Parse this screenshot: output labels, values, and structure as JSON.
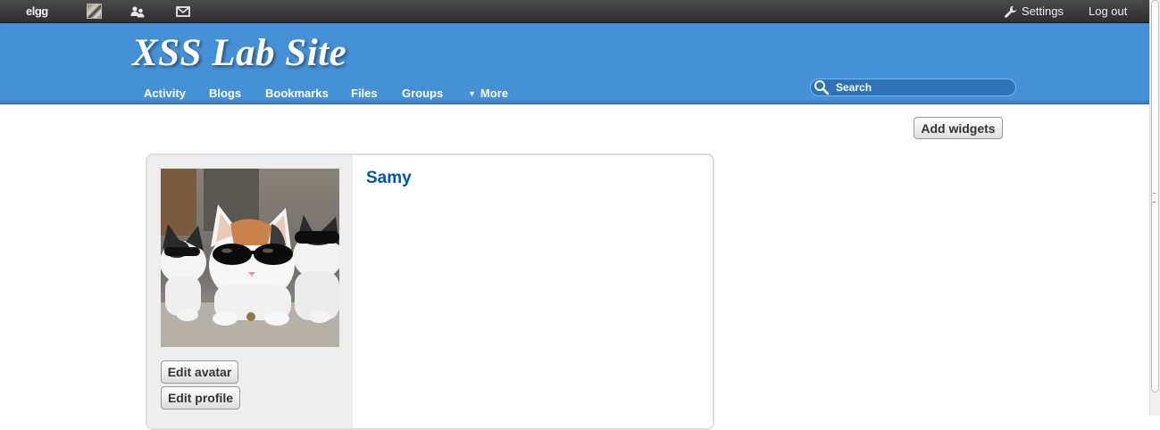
{
  "topbar": {
    "logo_text": "elgg",
    "friends_icon": "friends-icon",
    "messages_icon": "envelope-icon",
    "settings_label": "Settings",
    "settings_icon": "wrench-icon",
    "logout_label": "Log out"
  },
  "header": {
    "site_title": "XSS Lab Site",
    "menu": [
      {
        "label": "Activity"
      },
      {
        "label": "Blogs"
      },
      {
        "label": "Bookmarks"
      },
      {
        "label": "Files"
      },
      {
        "label": "Groups"
      },
      {
        "label": "More",
        "caret": "▼"
      }
    ],
    "search": {
      "placeholder": "Search",
      "icon": "magnifier-icon"
    }
  },
  "content": {
    "add_widgets_label": "Add widgets",
    "profile": {
      "name": "Samy",
      "photo_alt": "cats wearing sunglasses",
      "edit_avatar_label": "Edit avatar",
      "edit_profile_label": "Edit profile"
    }
  },
  "colors": {
    "topbar": "#333333",
    "header": "#4690d6",
    "link": "#0054a7",
    "owner_block": "#eeeeee"
  }
}
